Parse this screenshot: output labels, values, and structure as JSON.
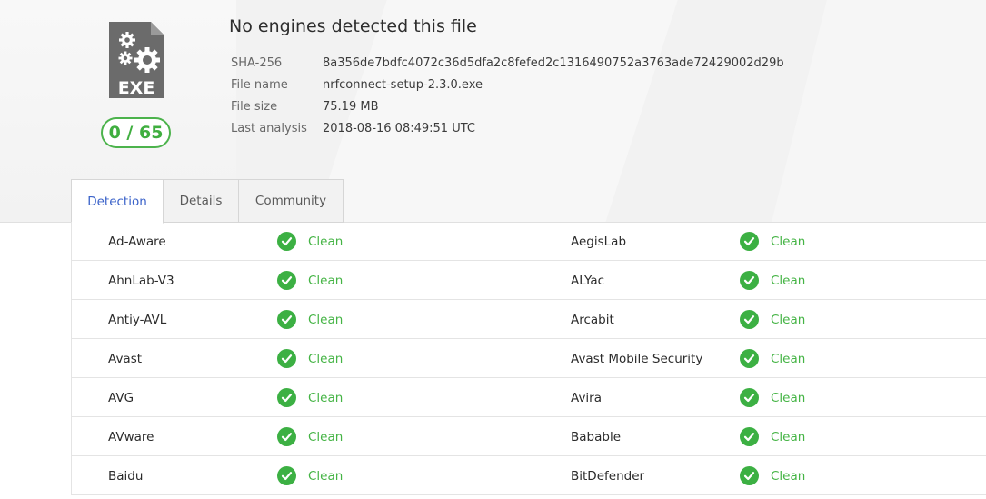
{
  "file": {
    "icon_label": "EXE",
    "score": "0 / 65",
    "title": "No engines detected this file",
    "meta": [
      {
        "key": "SHA-256",
        "value": "8a356de7bdfc4072c36d5dfa2c8fefed2c1316490752a3763ade72429002d29b"
      },
      {
        "key": "File name",
        "value": "nrfconnect-setup-2.3.0.exe"
      },
      {
        "key": "File size",
        "value": "75.19 MB"
      },
      {
        "key": "Last analysis",
        "value": "2018-08-16 08:49:51 UTC"
      }
    ]
  },
  "tabs": [
    {
      "label": "Detection",
      "active": true
    },
    {
      "label": "Details",
      "active": false
    },
    {
      "label": "Community",
      "active": false
    }
  ],
  "results": [
    {
      "left": {
        "engine": "Ad-Aware",
        "result": "Clean"
      },
      "right": {
        "engine": "AegisLab",
        "result": "Clean"
      }
    },
    {
      "left": {
        "engine": "AhnLab-V3",
        "result": "Clean"
      },
      "right": {
        "engine": "ALYac",
        "result": "Clean"
      }
    },
    {
      "left": {
        "engine": "Antiy-AVL",
        "result": "Clean"
      },
      "right": {
        "engine": "Arcabit",
        "result": "Clean"
      }
    },
    {
      "left": {
        "engine": "Avast",
        "result": "Clean"
      },
      "right": {
        "engine": "Avast Mobile Security",
        "result": "Clean"
      }
    },
    {
      "left": {
        "engine": "AVG",
        "result": "Clean"
      },
      "right": {
        "engine": "Avira",
        "result": "Clean"
      }
    },
    {
      "left": {
        "engine": "AVware",
        "result": "Clean"
      },
      "right": {
        "engine": "Babable",
        "result": "Clean"
      }
    },
    {
      "left": {
        "engine": "Baidu",
        "result": "Clean"
      },
      "right": {
        "engine": "BitDefender",
        "result": "Clean"
      }
    }
  ],
  "colors": {
    "clean_green": "#3cb043",
    "active_tab_blue": "#3a62c9",
    "icon_gray": "#6b6b6b"
  },
  "icons": {
    "file": "exe-file-icon",
    "check": "check-circle-icon"
  }
}
